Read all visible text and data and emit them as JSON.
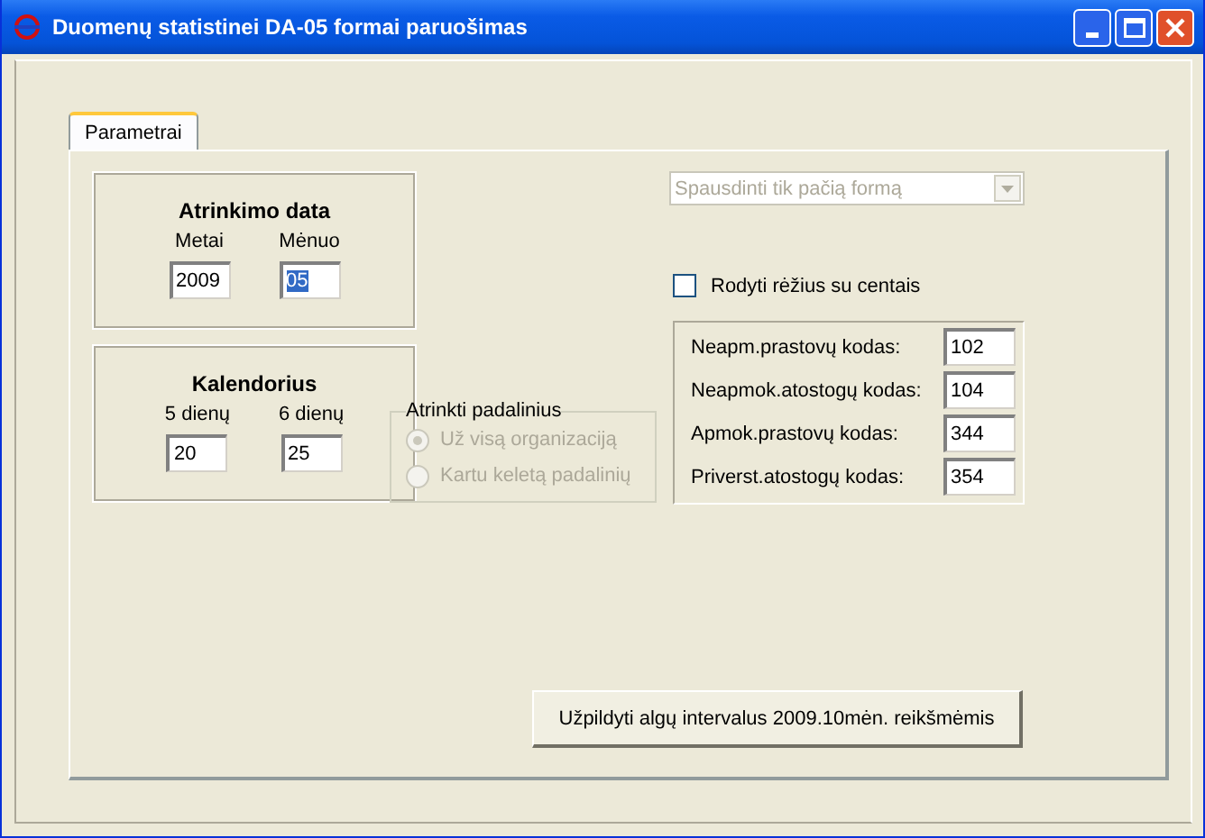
{
  "window": {
    "title": "Duomenų statistinei DA-05 formai paruošimas"
  },
  "tabs": [
    {
      "label": "Parametrai",
      "selected": true
    }
  ],
  "groups": [
    {
      "title": "Atrinkimo data",
      "fields": [
        {
          "label": "Metai",
          "value": "2009",
          "highlighted": false
        },
        {
          "label": "Mėnuo",
          "value": "05",
          "highlighted": true
        }
      ]
    },
    {
      "title": "Kalendorius",
      "fields": [
        {
          "label": "5 dienų",
          "value": "20",
          "highlighted": false
        },
        {
          "label": "6 dienų",
          "value": "25",
          "highlighted": false
        }
      ]
    }
  ],
  "division_group": {
    "title": "Atrinkti padalinius",
    "options": [
      {
        "label": "Už visą organizaciją",
        "selected": true,
        "disabled": true
      },
      {
        "label": "Kartu keletą padalinių",
        "selected": false,
        "disabled": true
      }
    ]
  },
  "print_combo": {
    "value": "Spausdinti tik pačią formą",
    "disabled": true
  },
  "cents_checkbox": {
    "label": "Rodyti rėžius su centais",
    "checked": false
  },
  "codes": [
    {
      "label": "Neapm.prastovų kodas:",
      "value": "102"
    },
    {
      "label": "Neapmok.atostogų kodas:",
      "value": "104"
    },
    {
      "label": "Apmok.prastovų kodas:",
      "value": "344"
    },
    {
      "label": "Priverst.atostogų kodas:",
      "value": "354"
    }
  ],
  "fill_button": {
    "label": "Užpildyti algų intervalus 2009.10mėn. reikšmėmis"
  }
}
